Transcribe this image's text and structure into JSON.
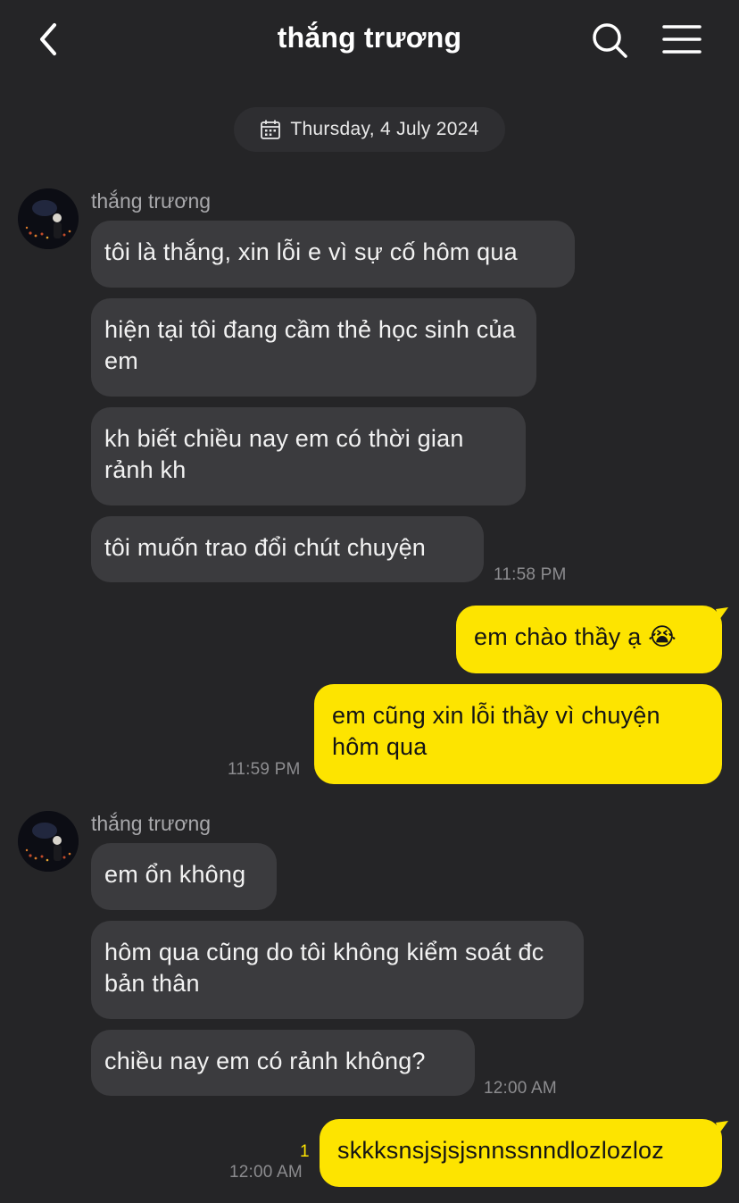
{
  "header": {
    "title": "thắng trương",
    "back_icon": "chevron-left-icon",
    "search_icon": "search-icon",
    "menu_icon": "hamburger-menu-icon"
  },
  "date_chip": {
    "icon": "calendar-icon",
    "label": "Thursday, 4 July 2024"
  },
  "colors": {
    "background": "#252527",
    "incoming_bubble": "#3b3b3e",
    "outgoing_bubble": "#fde400",
    "unread_count": "#fde400"
  },
  "group1": {
    "sender": "thắng trương",
    "messages": [
      "tôi là thắng, xin lỗi e vì sự cố hôm qua",
      "hiện tại tôi đang cầm thẻ học sinh của em",
      "kh biết chiều nay em có thời gian rảnh kh",
      "tôi muốn trao đổi chút chuyện"
    ],
    "time": "11:58 PM"
  },
  "group2": {
    "messages": [
      "em chào thầy ạ 😭",
      "em cũng xin lỗi thầy vì chuyện hôm qua"
    ],
    "time": "11:59 PM"
  },
  "group3": {
    "sender": "thắng trương",
    "messages": [
      "em ổn không",
      "hôm qua cũng do tôi không kiểm soát đc bản thân",
      "chiều nay em có rảnh không?"
    ],
    "time": "12:00 AM"
  },
  "group4": {
    "messages": [
      "skkksnsjsjsjsnnssnndlozlozloz"
    ],
    "unread": "1",
    "time": "12:00 AM"
  }
}
